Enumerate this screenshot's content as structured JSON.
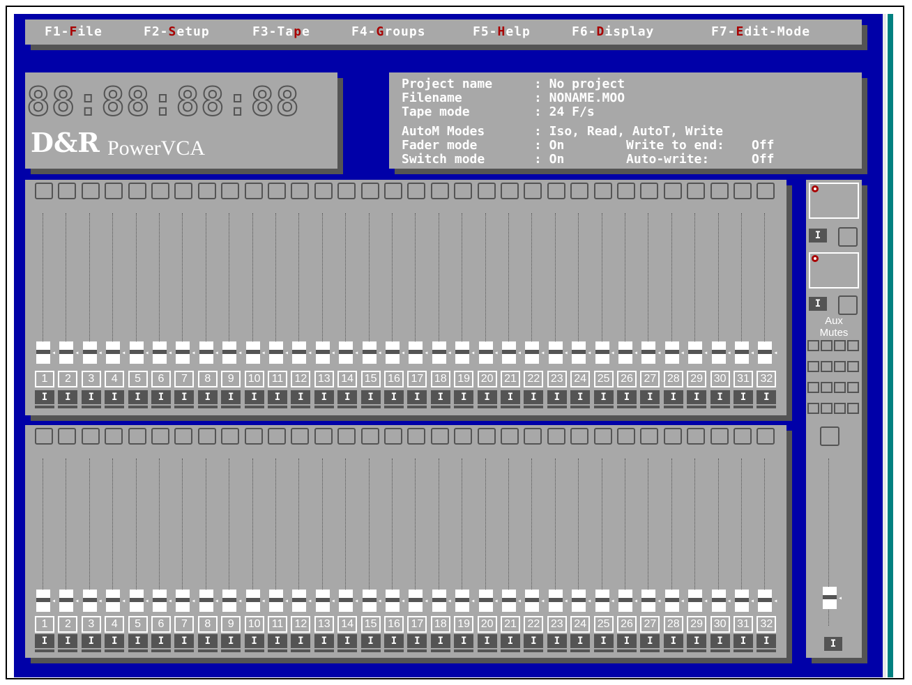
{
  "menu": [
    {
      "pre": "F1-",
      "hot": "F",
      "post": "ile",
      "name": "menu-file"
    },
    {
      "pre": "F2-",
      "hot": "S",
      "post": "etup",
      "name": "menu-setup"
    },
    {
      "pre": "F3-Ta",
      "hot": "p",
      "post": "e",
      "name": "menu-tape"
    },
    {
      "pre": "F4-",
      "hot": "G",
      "post": "roups",
      "name": "menu-groups"
    },
    {
      "pre": "F5-",
      "hot": "H",
      "post": "elp",
      "name": "menu-help"
    },
    {
      "pre": "F6-",
      "hot": "D",
      "post": "isplay",
      "name": "menu-display"
    },
    {
      "pre": "F7-",
      "hot": "E",
      "post": "dit-Mode",
      "name": "menu-edit-mode"
    }
  ],
  "timecode": "88:88:88:88",
  "logo": "D&R",
  "product": "PowerVCA",
  "info": {
    "project_label": "Project name",
    "project_value": ": No project",
    "filename_label": "Filename",
    "filename_value": ": NONAME.MOO",
    "tapemode_label": "Tape mode",
    "tapemode_value": ": 24 F/s",
    "autom_label": "AutoM Modes",
    "autom_value": ": Iso, Read, AutoT, Write",
    "fader_label": "Fader mode",
    "fader_value": ": On",
    "switch_label": "Switch mode",
    "switch_value": ": On",
    "write_end_label": "Write to end:",
    "write_end_value": "Off",
    "auto_write_label": "Auto-write:",
    "auto_write_value": "Off"
  },
  "channel_count": 32,
  "channels": [
    "1",
    "2",
    "3",
    "4",
    "5",
    "6",
    "7",
    "8",
    "9",
    "10",
    "11",
    "12",
    "13",
    "14",
    "15",
    "16",
    "17",
    "18",
    "19",
    "20",
    "21",
    "22",
    "23",
    "24",
    "25",
    "26",
    "27",
    "28",
    "29",
    "30",
    "31",
    "32"
  ],
  "i_label": "I",
  "aux_label_1": "Aux",
  "aux_label_2": "Mutes",
  "colors": {
    "background": "#0000a8",
    "panel": "#a8a8a8",
    "shadow": "#545454",
    "hotkey": "#a80000",
    "teal": "#008080"
  }
}
